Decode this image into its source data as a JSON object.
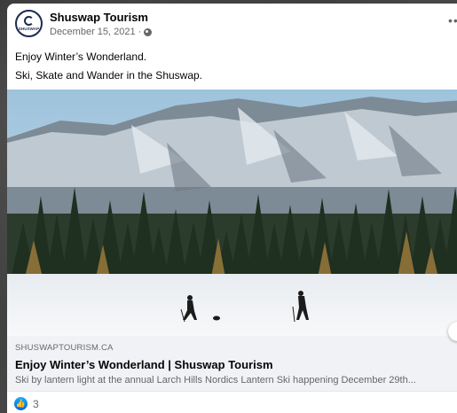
{
  "post": {
    "page_name": "Shuswap Tourism",
    "avatar_text": "SHUSWAP",
    "date": "December 15, 2021 ·",
    "text_line1": "Enjoy Winter’s Wonderland.",
    "text_line2": "Ski, Skate and Wander in the Shuswap.",
    "more_icon": "ellipsis-icon",
    "privacy_icon": "globe-icon"
  },
  "link_preview": {
    "domain": "SHUSWAPTOURISM.CA",
    "title": "Enjoy Winter’s Wonderland | Shuswap Tourism",
    "description": "Ski by lantern light at the annual Larch Hills Nordics Lantern Ski happening December 29th..."
  },
  "reactions": {
    "icon": "like-icon",
    "count": "3",
    "color": "#1877f2"
  }
}
